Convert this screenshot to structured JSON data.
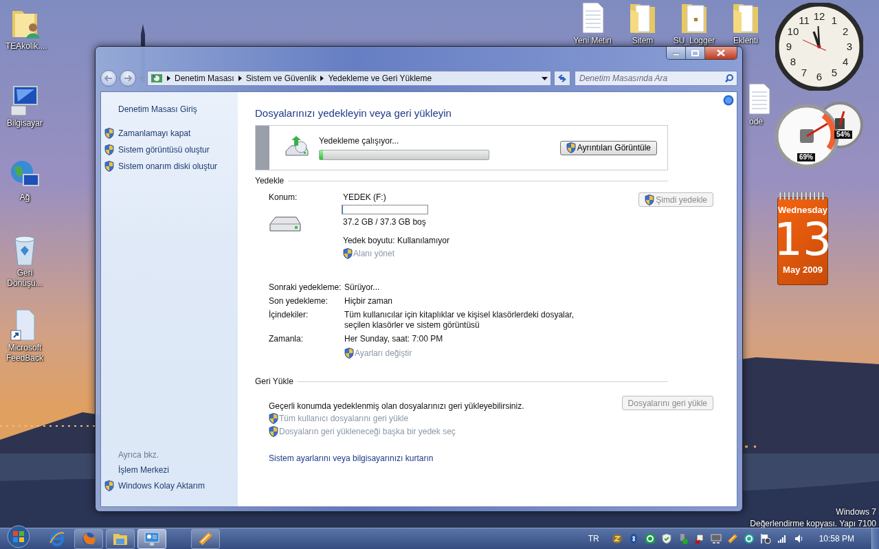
{
  "desktop_icons": [
    {
      "label": "TEAkolik....",
      "kind": "user-folder"
    },
    {
      "label": "Bilgisayar",
      "kind": "computer"
    },
    {
      "label": "Ağ",
      "kind": "network"
    },
    {
      "label": "Geri Dönüşü...",
      "kind": "recycle"
    },
    {
      "label": "Microsoft FeedBack",
      "kind": "document-shortcut"
    }
  ],
  "top_icons": [
    {
      "label": "Yeni Metin",
      "kind": "text-file"
    },
    {
      "label": "Sitem",
      "kind": "folder"
    },
    {
      "label": "SU_Logger",
      "kind": "locked-folder"
    },
    {
      "label": "Eklenti",
      "kind": "folder"
    },
    {
      "label": "ode",
      "kind": "text-file"
    }
  ],
  "clock": {
    "numerals": [
      "12",
      "11",
      "1",
      "10",
      "2",
      "9",
      "3",
      "8",
      "4",
      "7",
      "5",
      "6"
    ]
  },
  "meter": {
    "cpu": "69%",
    "memory": "54%"
  },
  "calendar": {
    "weekday": "Wednesday",
    "day": "13",
    "month_year": "May 2009"
  },
  "os_notice": [
    "Windows 7",
    "Değerlendirme kopyası. Yapı 7100"
  ],
  "window": {
    "breadcrumbs": [
      "Denetim Masası",
      "Sistem ve Güvenlik",
      "Yedekleme ve Geri Yükleme"
    ],
    "search": {
      "placeholder": "Denetim Masasında Ara"
    },
    "sidebar": {
      "home": "Denetim Masası Giriş",
      "tasks": [
        {
          "label": "Zamanlamayı kapat",
          "shield": true
        },
        {
          "label": "Sistem görüntüsü oluştur",
          "shield": true
        },
        {
          "label": "Sistem onarım diski oluştur",
          "shield": true
        }
      ],
      "see_also_title": "Ayrıca bkz.",
      "see_also": [
        {
          "label": "İşlem Merkezi",
          "shield": false
        },
        {
          "label": "Windows Kolay Aktarım",
          "shield": true
        }
      ]
    },
    "title": "Dosyalarınızı yedekleyin veya geri yükleyin",
    "status": {
      "text": "Yedekleme çalışıyor...",
      "level": 0.02,
      "button": {
        "label": "Ayrıntıları Görüntüle",
        "disabled": false
      }
    },
    "backup": {
      "heading": "Yedekle",
      "location_label": "Konum:",
      "drive": "YEDEK (F:)",
      "usage": {
        "level": 0.01
      },
      "space": "37.2 GB / 37.3 GB boş",
      "size": "Yedek boyutu: Kullanılamıyor",
      "manage_link": {
        "label": "Alanı yönet",
        "disabled": true
      },
      "button": {
        "label": "Şimdi yedekle",
        "disabled": true
      },
      "details": [
        {
          "label": "Sonraki yedekleme:",
          "value": "Sürüyor..."
        },
        {
          "label": "Son yedekleme:",
          "value": "Hiçbir zaman"
        },
        {
          "label": "İçindekiler:",
          "value": "Tüm kullanıcılar için kitaplıklar ve kişisel klasörlerdeki dosyalar, seçilen klasörler ve sistem görüntüsü"
        },
        {
          "label": "Zamanla:",
          "value": "Her Sunday, saat: 7:00 PM"
        }
      ],
      "settings_link": {
        "label": "Ayarları değiştir",
        "disabled": true
      }
    },
    "restore": {
      "heading": "Geri Yükle",
      "text": "Geçerli konumda yedeklenmiş olan dosyalarınızı geri yükleyebilirsiniz.",
      "button": {
        "label": "Dosyalarını geri yükle",
        "disabled": true
      },
      "links": [
        {
          "label": "Tüm kullanıcı dosyalarını geri yükle",
          "disabled": true
        },
        {
          "label": "Dosyaların geri yükleneceği başka bir yedek seç",
          "disabled": true
        }
      ],
      "recover_link": {
        "label": "Sistem ayarlarını veya bilgisayarınızı kurtarın",
        "disabled": false
      }
    }
  },
  "taskbar": {
    "apps": [
      {
        "kind": "ie",
        "selected": false,
        "button": false
      },
      {
        "kind": "firefox",
        "selected": false,
        "button": true
      },
      {
        "kind": "explorer",
        "selected": false,
        "button": true
      },
      {
        "kind": "control-panel",
        "selected": true,
        "button": true
      },
      {
        "kind": "media",
        "selected": false,
        "button": true
      }
    ],
    "language": "TR",
    "tray": [
      {
        "kind": "z"
      },
      {
        "kind": "bluetooth"
      },
      {
        "kind": "ring"
      },
      {
        "kind": "shield"
      },
      {
        "kind": "usb"
      },
      {
        "kind": "power"
      },
      {
        "kind": "monitor"
      },
      {
        "kind": "media"
      },
      {
        "kind": "circle"
      },
      {
        "kind": "flag"
      },
      {
        "kind": "signal"
      },
      {
        "kind": "speaker"
      }
    ],
    "time": "10:58 PM"
  }
}
